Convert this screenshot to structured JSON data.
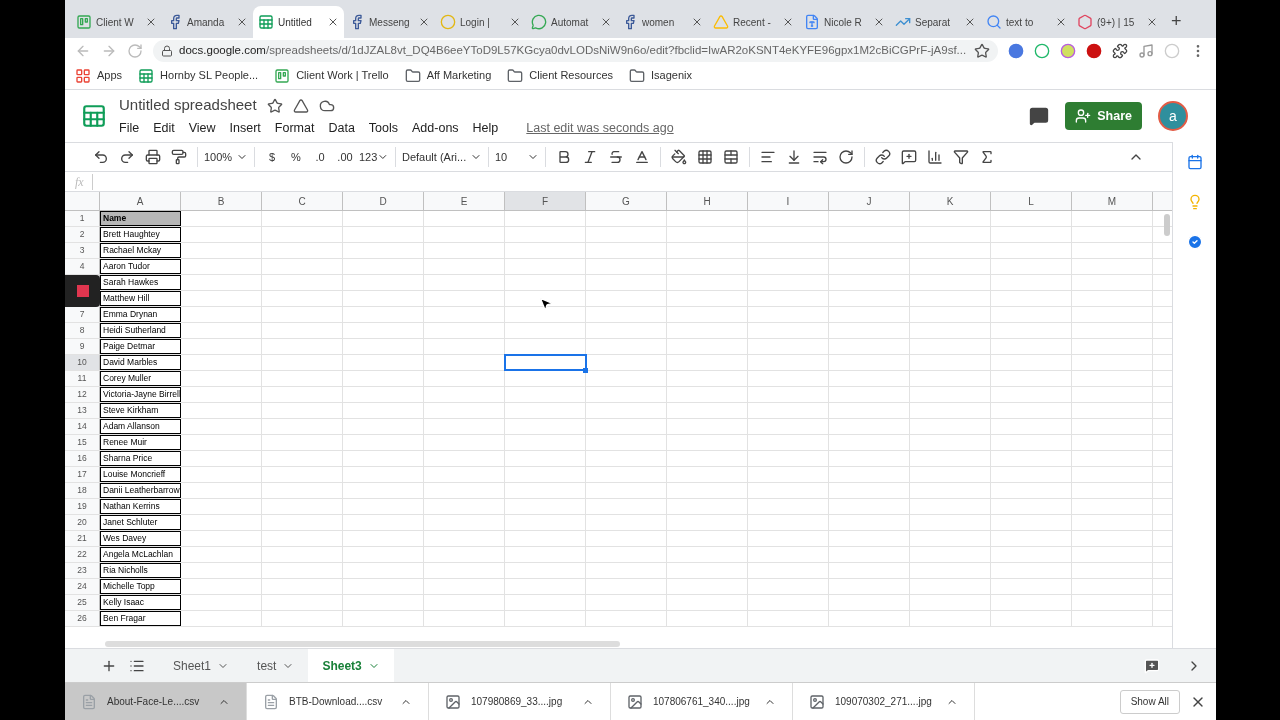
{
  "browser": {
    "tabs": [
      {
        "title": "Client W",
        "kind": "board",
        "selected": false
      },
      {
        "title": "Amanda",
        "kind": "social",
        "selected": false
      },
      {
        "title": "Untitled",
        "kind": "sheet",
        "selected": true
      },
      {
        "title": "Messeng",
        "kind": "social",
        "selected": false
      },
      {
        "title": "Login |",
        "kind": "chimp",
        "selected": false
      },
      {
        "title": "Automat",
        "kind": "chat",
        "selected": false
      },
      {
        "title": "women",
        "kind": "social",
        "selected": false
      },
      {
        "title": "Recent -",
        "kind": "drive",
        "selected": false
      },
      {
        "title": "Nicole R",
        "kind": "doc",
        "selected": false
      },
      {
        "title": "Separat",
        "kind": "chart",
        "selected": false
      },
      {
        "title": "text to",
        "kind": "search",
        "selected": false
      },
      {
        "title": "(9+) | 15",
        "kind": "ring",
        "selected": false
      }
    ],
    "new_tab": "+",
    "url_host": "docs.google.com",
    "url_path": "/spreadsheets/d/1dJZAL8vt_DQ4B6eeYToD9L57KGcya0dvLODsNiW9n6o/edit?fbclid=IwAR2oKSNT4eKYFE96gpx1M2cBiCGPrF-jA9sf...",
    "bookmarks": [
      {
        "label": "Apps",
        "kind": "apps"
      },
      {
        "label": "Hornby SL People...",
        "kind": "sheet"
      },
      {
        "label": "Client Work | Trello",
        "kind": "board"
      },
      {
        "label": "Aff Marketing",
        "kind": "folder"
      },
      {
        "label": "Client Resources",
        "kind": "folder"
      },
      {
        "label": "Isagenix",
        "kind": "folder"
      }
    ]
  },
  "doc": {
    "title": "Untitled spreadsheet",
    "menu": [
      "File",
      "Edit",
      "View",
      "Insert",
      "Format",
      "Data",
      "Tools",
      "Add-ons",
      "Help"
    ],
    "last_edit": "Last edit was seconds ago",
    "share": "Share",
    "avatar": "a"
  },
  "toolbar": {
    "zoom": "100%",
    "currency": "$",
    "percent": "%",
    "decrease_decimal": ".0",
    "increase_decimal": ".00",
    "more_formats": "123",
    "font": "Default (Ari...",
    "font_size": "10"
  },
  "formula_bar": {
    "label": "fx"
  },
  "sheet": {
    "columns": [
      {
        "label": "A",
        "selected": false
      },
      {
        "label": "B",
        "selected": false
      },
      {
        "label": "C",
        "selected": false
      },
      {
        "label": "D",
        "selected": false
      },
      {
        "label": "E",
        "selected": false
      },
      {
        "label": "F",
        "selected": true
      },
      {
        "label": "G",
        "selected": false
      },
      {
        "label": "H",
        "selected": false
      },
      {
        "label": "I",
        "selected": false
      },
      {
        "label": "J",
        "selected": false
      },
      {
        "label": "K",
        "selected": false
      },
      {
        "label": "L",
        "selected": false
      },
      {
        "label": "M",
        "selected": false
      }
    ],
    "rows": [
      {
        "number": "1",
        "name": "Name",
        "header": true,
        "selected": false
      },
      {
        "number": "2",
        "name": "Brett Haughtey",
        "header": false,
        "selected": false
      },
      {
        "number": "3",
        "name": "Rachael Mckay",
        "header": false,
        "selected": false
      },
      {
        "number": "4",
        "name": "Aaron Tudor",
        "header": false,
        "selected": false
      },
      {
        "name": "Sarah Hawkes",
        "header": false
      },
      {
        "name": "Matthew Hill",
        "header": false
      },
      {
        "number": "7",
        "name": "Emma Drynan",
        "header": false,
        "selected": false
      },
      {
        "number": "8",
        "name": "Heidi Sutherland",
        "header": false,
        "selected": false
      },
      {
        "number": "9",
        "name": "Paige Detmar",
        "header": false,
        "selected": false
      },
      {
        "number": "10",
        "name": "David Marbles",
        "header": false,
        "selected": true
      },
      {
        "number": "11",
        "name": "Corey Muller",
        "header": false,
        "selected": false
      },
      {
        "number": "12",
        "name": "Victoria-Jayne Birrell",
        "header": false,
        "selected": false
      },
      {
        "number": "13",
        "name": "Steve Kirkham",
        "header": false,
        "selected": false
      },
      {
        "number": "14",
        "name": "Adam Allanson",
        "header": false,
        "selected": false
      },
      {
        "number": "15",
        "name": "Renee Muir",
        "header": false,
        "selected": false
      },
      {
        "number": "16",
        "name": "Sharna Price",
        "header": false,
        "selected": false
      },
      {
        "number": "17",
        "name": "Louise Moncrieff",
        "header": false,
        "selected": false
      },
      {
        "number": "18",
        "name": "Danii Leatherbarrow",
        "header": false,
        "selected": false
      },
      {
        "number": "19",
        "name": "Nathan Kerrins",
        "header": false,
        "selected": false
      },
      {
        "number": "20",
        "name": "Janet Schluter",
        "header": false,
        "selected": false
      },
      {
        "number": "21",
        "name": "Wes Davey",
        "header": false,
        "selected": false
      },
      {
        "number": "22",
        "name": "Angela McLachlan",
        "header": false,
        "selected": false
      },
      {
        "number": "23",
        "name": "Ria Nicholls",
        "header": false,
        "selected": false
      },
      {
        "number": "24",
        "name": "Michelle Topp",
        "header": false,
        "selected": false
      },
      {
        "number": "25",
        "name": "Kelly Isaac",
        "header": false,
        "selected": false
      },
      {
        "number": "26",
        "name": "Ben Fragar",
        "header": false,
        "selected": false
      }
    ]
  },
  "sheet_tabs": [
    {
      "label": "Sheet1",
      "selected": false
    },
    {
      "label": "test",
      "selected": false
    },
    {
      "label": "Sheet3",
      "selected": true
    }
  ],
  "downloads": [
    {
      "filename": "About-Face-Le....csv",
      "kind": "csv",
      "selected": true
    },
    {
      "filename": "BTB-Download....csv",
      "kind": "csv",
      "selected": false
    },
    {
      "filename": "107980869_33....jpg",
      "kind": "jpg",
      "selected": false
    },
    {
      "filename": "107806761_340....jpg",
      "kind": "jpg",
      "selected": false
    },
    {
      "filename": "109070302_271....jpg",
      "kind": "jpg",
      "selected": false
    }
  ],
  "show_all": "Show All"
}
